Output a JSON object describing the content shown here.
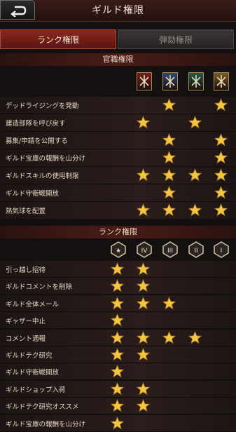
{
  "header": {
    "title": "ギルド権限"
  },
  "tabs": [
    {
      "label": "ランク権限",
      "active": true
    },
    {
      "label": "弾劾権限",
      "active": false
    }
  ],
  "official_section": {
    "title": "官職権限",
    "roles": [
      {
        "icon": "crossed-swords-emblem-icon",
        "color": "#7a1e1a"
      },
      {
        "icon": "eagle-emblem-icon",
        "color": "#2a4a7a"
      },
      {
        "icon": "castle-emblem-icon",
        "color": "#1f5a4a"
      },
      {
        "icon": "lion-emblem-icon",
        "color": "#7a5a22"
      }
    ],
    "rows": [
      {
        "label": "デッドライジングを発動",
        "stars": [
          false,
          true,
          false,
          true
        ]
      },
      {
        "label": "建造部隊を呼び戻す",
        "stars": [
          true,
          false,
          true,
          false
        ]
      },
      {
        "label": "募集/申請を公開する",
        "stars": [
          false,
          true,
          false,
          true
        ]
      },
      {
        "label": "ギルド宝庫の報酬を山分け",
        "stars": [
          false,
          true,
          false,
          true
        ]
      },
      {
        "label": "ギルドスキルの使用制限",
        "stars": [
          true,
          true,
          true,
          true
        ]
      },
      {
        "label": "ギルド守衛戦開放",
        "stars": [
          false,
          true,
          false,
          true
        ]
      },
      {
        "label": "熱気球を配置",
        "stars": [
          true,
          true,
          true,
          true
        ]
      }
    ]
  },
  "rank_section": {
    "title": "ランク権限",
    "ranks": [
      {
        "icon": "rank-5-badge-icon",
        "label": "★"
      },
      {
        "icon": "rank-4-badge-icon",
        "label": "IV"
      },
      {
        "icon": "rank-3-badge-icon",
        "label": "III"
      },
      {
        "icon": "rank-2-badge-icon",
        "label": "II"
      },
      {
        "icon": "rank-1-badge-icon",
        "label": "I"
      }
    ],
    "rows": [
      {
        "label": "引っ越し招待",
        "stars": [
          true,
          true,
          false,
          false,
          false
        ]
      },
      {
        "label": "ギルドコメントを削除",
        "stars": [
          true,
          true,
          false,
          false,
          false
        ]
      },
      {
        "label": "ギルド全体メール",
        "stars": [
          true,
          true,
          true,
          false,
          false
        ]
      },
      {
        "label": "ギャザー中止",
        "stars": [
          true,
          false,
          false,
          false,
          false
        ]
      },
      {
        "label": "コメント通報",
        "stars": [
          true,
          true,
          true,
          true,
          false
        ]
      },
      {
        "label": "ギルドテク研究",
        "stars": [
          true,
          true,
          false,
          false,
          false
        ]
      },
      {
        "label": "ギルド守衛戦開放",
        "stars": [
          true,
          false,
          false,
          false,
          false
        ]
      },
      {
        "label": "ギルドショップ入荷",
        "stars": [
          true,
          true,
          false,
          false,
          false
        ]
      },
      {
        "label": "ギルドテク研究オススメ",
        "stars": [
          true,
          true,
          false,
          false,
          false
        ]
      },
      {
        "label": "ギルド宝庫の報酬を山分け",
        "stars": [
          true,
          false,
          false,
          false,
          false
        ]
      }
    ]
  }
}
